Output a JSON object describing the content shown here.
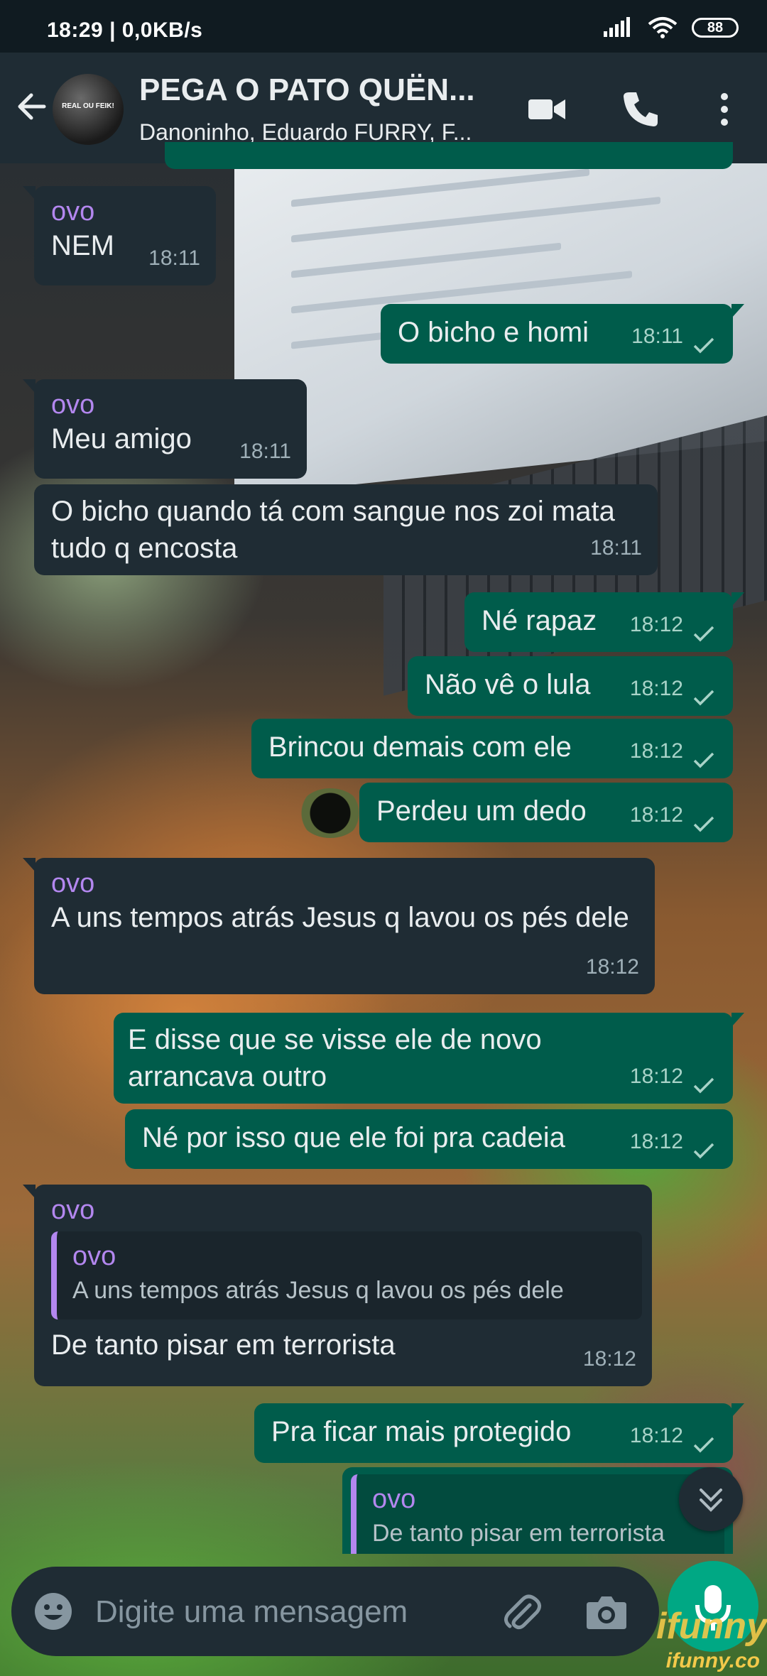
{
  "status_bar": {
    "time": "18:29 | 0,0KB/s",
    "battery": "88"
  },
  "header": {
    "title": "PEGA O PATO QUËN...",
    "subtitle": "Danoninho, Eduardo FURRY, F...",
    "avatar_text": "REAL OU FEIK!"
  },
  "messages": [
    {
      "dir": "in",
      "sender": "ovo",
      "text": "NEM",
      "time": "18:11"
    },
    {
      "dir": "out",
      "text": "O bicho e homi",
      "time": "18:11"
    },
    {
      "dir": "in",
      "sender": "ovo",
      "text": "Meu amigo",
      "time": "18:11"
    },
    {
      "dir": "in",
      "text": "O bicho quando tá com sangue nos zoi mata tudo q encosta",
      "time": "18:11"
    },
    {
      "dir": "out",
      "text": "Né rapaz",
      "time": "18:12"
    },
    {
      "dir": "out",
      "text": "Não vê o lula",
      "time": "18:12"
    },
    {
      "dir": "out",
      "text": "Brincou demais com ele",
      "time": "18:12"
    },
    {
      "dir": "out",
      "text": "Perdeu um dedo",
      "time": "18:12"
    },
    {
      "dir": "in",
      "sender": "ovo",
      "text": "A uns tempos atrás Jesus q lavou os pés dele",
      "time": "18:12"
    },
    {
      "dir": "out",
      "text": "E disse que se visse ele de novo arrancava outro",
      "time": "18:12"
    },
    {
      "dir": "out",
      "text": "Né por isso que ele foi pra cadeia",
      "time": "18:12"
    },
    {
      "dir": "in",
      "sender": "ovo",
      "quote_name": "ovo",
      "quote_text": "A uns tempos atrás Jesus q lavou os pés dele",
      "text": "De tanto pisar em terrorista",
      "time": "18:12"
    },
    {
      "dir": "out",
      "text": "Pra ficar mais protegido",
      "time": "18:12"
    },
    {
      "dir": "out",
      "quote_name": "ovo",
      "quote_text": "De tanto pisar em terrorista"
    }
  ],
  "composer": {
    "placeholder": "Digite uma mensagem"
  },
  "watermark": {
    "brand": "ifunny.co",
    "big": "ifunny"
  },
  "colors": {
    "header": "#1f2c34",
    "incoming": "#1f2c34",
    "outgoing": "#005c4b",
    "sender": "#b387ef",
    "accent": "#00a884"
  },
  "icons": [
    "back-arrow-icon",
    "video-call-icon",
    "phone-icon",
    "more-vert-icon",
    "double-chevron-down-icon",
    "emoji-icon",
    "attach-icon",
    "camera-icon",
    "mic-icon",
    "read-check-icon"
  ]
}
